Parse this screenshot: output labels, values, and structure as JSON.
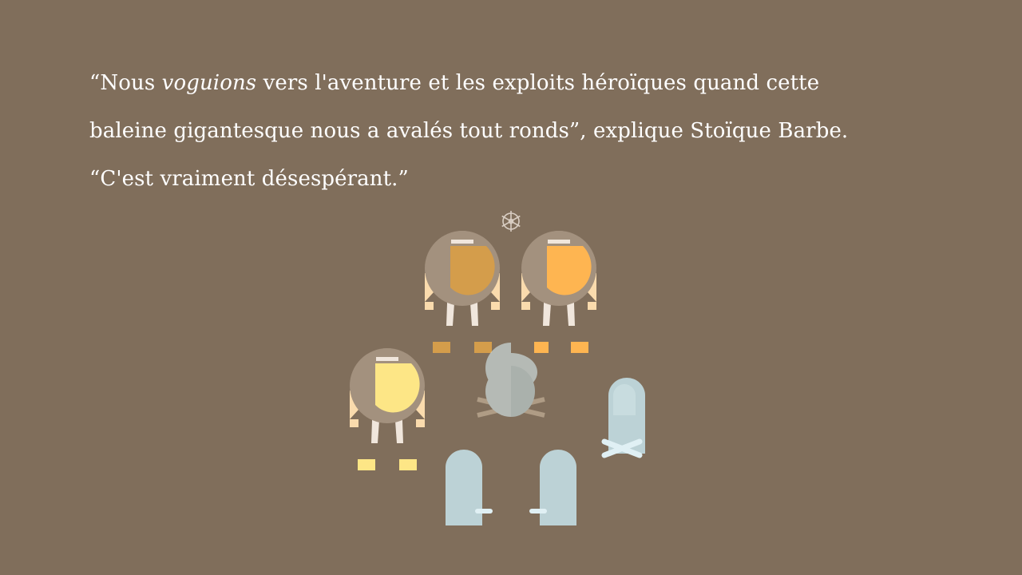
{
  "narration": {
    "open_quote": "“Nous ",
    "emphasis": "voguions",
    "rest": " vers l'aventure et les exploits héroïques quand cette baleine gigantesque nous a avalés tout ronds”, explique Stoïque Barbe. “C'est vraiment désespérant.”"
  },
  "scene": {
    "background": "#806e5b",
    "characters": [
      {
        "name": "sailor-dark-beard",
        "beard": "#d49d4b",
        "boots": "#d49d4b"
      },
      {
        "name": "sailor-orange-beard",
        "beard": "#feb551",
        "boots": "#feb551"
      },
      {
        "name": "sailor-yellow-beard",
        "beard": "#fde686",
        "boots": "#fde686"
      }
    ],
    "ghost_color": "#c4dade",
    "campfire_color": "#bccbcb",
    "wheel_icon": "ship-wheel-icon"
  }
}
